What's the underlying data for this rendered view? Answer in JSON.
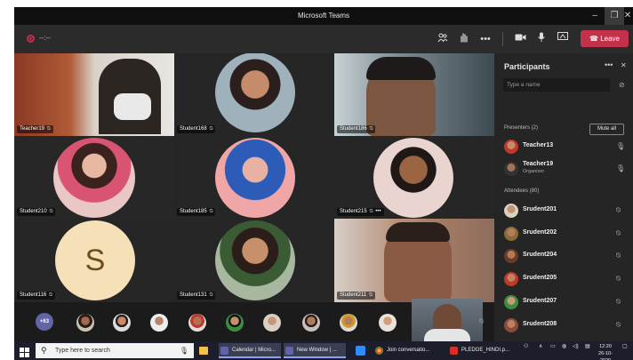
{
  "window": {
    "title": "Microsoft Teams",
    "minimize": "–",
    "maximize": "❐",
    "close": "✕"
  },
  "toolbar": {
    "timer": "--:--",
    "leave_label": "Leave",
    "icons": [
      "people-icon",
      "raise-hand-icon",
      "more-actions-icon",
      "camera-icon",
      "mic-icon",
      "share-screen-icon"
    ]
  },
  "tiles": [
    {
      "name": "Teacher19"
    },
    {
      "name": "Student168"
    },
    {
      "name": "Student186"
    },
    {
      "name": "Student210"
    },
    {
      "name": "Student185"
    },
    {
      "name": "Student215"
    },
    {
      "name": "Student116",
      "initial": "S"
    },
    {
      "name": "Student131"
    },
    {
      "name": "Student211"
    }
  ],
  "strip": {
    "more_count": "+63"
  },
  "panel": {
    "title": "Participants",
    "search_placeholder": "Type a name",
    "presenters_label": "Presenters (2)",
    "mute_all_label": "Mute all",
    "attendees_label": "Attendees (80)",
    "presenters": [
      {
        "name": "Teacher13",
        "role": ""
      },
      {
        "name": "Teacher19",
        "role": "Organizer"
      }
    ],
    "attendees": [
      {
        "name": "Srudent201"
      },
      {
        "name": "Srudent202"
      },
      {
        "name": "Srudent204"
      },
      {
        "name": "Srudent205"
      },
      {
        "name": "Srudent207"
      },
      {
        "name": "Srudent208"
      }
    ]
  },
  "taskbar": {
    "search_placeholder": "Type here to search",
    "tasks": [
      {
        "label": "Calendar | Micro..."
      },
      {
        "label": "New Window | ..."
      },
      {
        "label": "Join conversatio..."
      },
      {
        "label": "PLEDGE_HINDI.p..."
      }
    ],
    "time": "12:20",
    "date": "26-10-2020"
  },
  "colors": {
    "leave_red": "#c4314b",
    "teams_purple": "#6264a7",
    "window_bg": "#1f1f1f",
    "panel_bg": "#252525"
  }
}
